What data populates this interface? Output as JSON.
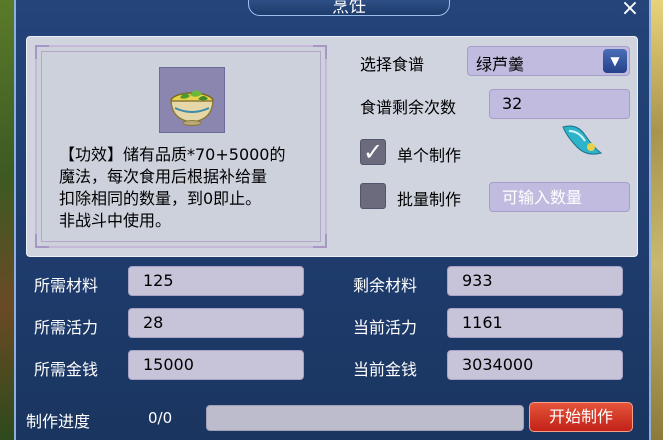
{
  "window": {
    "title": "烹饪",
    "close_symbol": "×"
  },
  "item": {
    "icon": "soup-bowl-icon",
    "description_lines": [
      "【功效】储有品质*70+5000的",
      "魔法，每次食用后根据补给量",
      "扣除相同的数量，到0即止。",
      "非战斗中使用。"
    ]
  },
  "recipe": {
    "label": "选择食谱",
    "selected": "绿芦羹",
    "dropdown_icon": "chevron-down-icon",
    "remaining_label": "食谱剩余次数",
    "remaining_value": "32"
  },
  "options": {
    "single": {
      "label": "单个制作",
      "checked": true
    },
    "batch": {
      "label": "批量制作",
      "checked": false,
      "placeholder": "可输入数量"
    }
  },
  "stats": {
    "required_material": {
      "label": "所需材料",
      "value": "125"
    },
    "remaining_material": {
      "label": "剩余材料",
      "value": "933"
    },
    "required_energy": {
      "label": "所需活力",
      "value": "28"
    },
    "current_energy": {
      "label": "当前活力",
      "value": "1161"
    },
    "required_money": {
      "label": "所需金钱",
      "value": "15000"
    },
    "current_money": {
      "label": "当前金钱",
      "value": "3034000"
    }
  },
  "progress": {
    "label": "制作进度",
    "text": "0/0",
    "fraction": 0
  },
  "start_button": {
    "label": "开始制作"
  },
  "colors": {
    "window_bg": "#1e3c6e",
    "panel_bg": "#cfd4de",
    "input_bg": "#c1bbe0",
    "start_button": "#d63a26"
  }
}
